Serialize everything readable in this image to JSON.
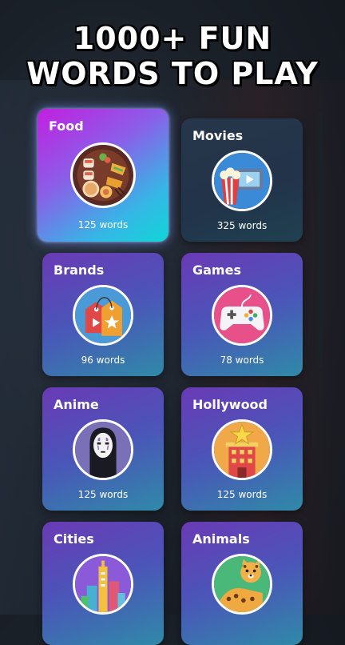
{
  "headline": {
    "line1": "1000+ FUN",
    "line2": "WORDS TO PLAY"
  },
  "categories": [
    {
      "name": "Food",
      "count": "125 words",
      "icon": "food-platter-icon"
    },
    {
      "name": "Movies",
      "count": "325 words",
      "icon": "popcorn-film-icon"
    },
    {
      "name": "Brands",
      "count": "96 words",
      "icon": "price-tags-icon"
    },
    {
      "name": "Games",
      "count": "78 words",
      "icon": "gamepad-icon"
    },
    {
      "name": "Anime",
      "count": "125 words",
      "icon": "masked-spirit-icon"
    },
    {
      "name": "Hollywood",
      "count": "125 words",
      "icon": "star-building-icon"
    },
    {
      "name": "Cities",
      "count": "",
      "icon": "skyline-icon"
    },
    {
      "name": "Animals",
      "count": "",
      "icon": "leopard-icon"
    }
  ],
  "selected_category": "Food"
}
